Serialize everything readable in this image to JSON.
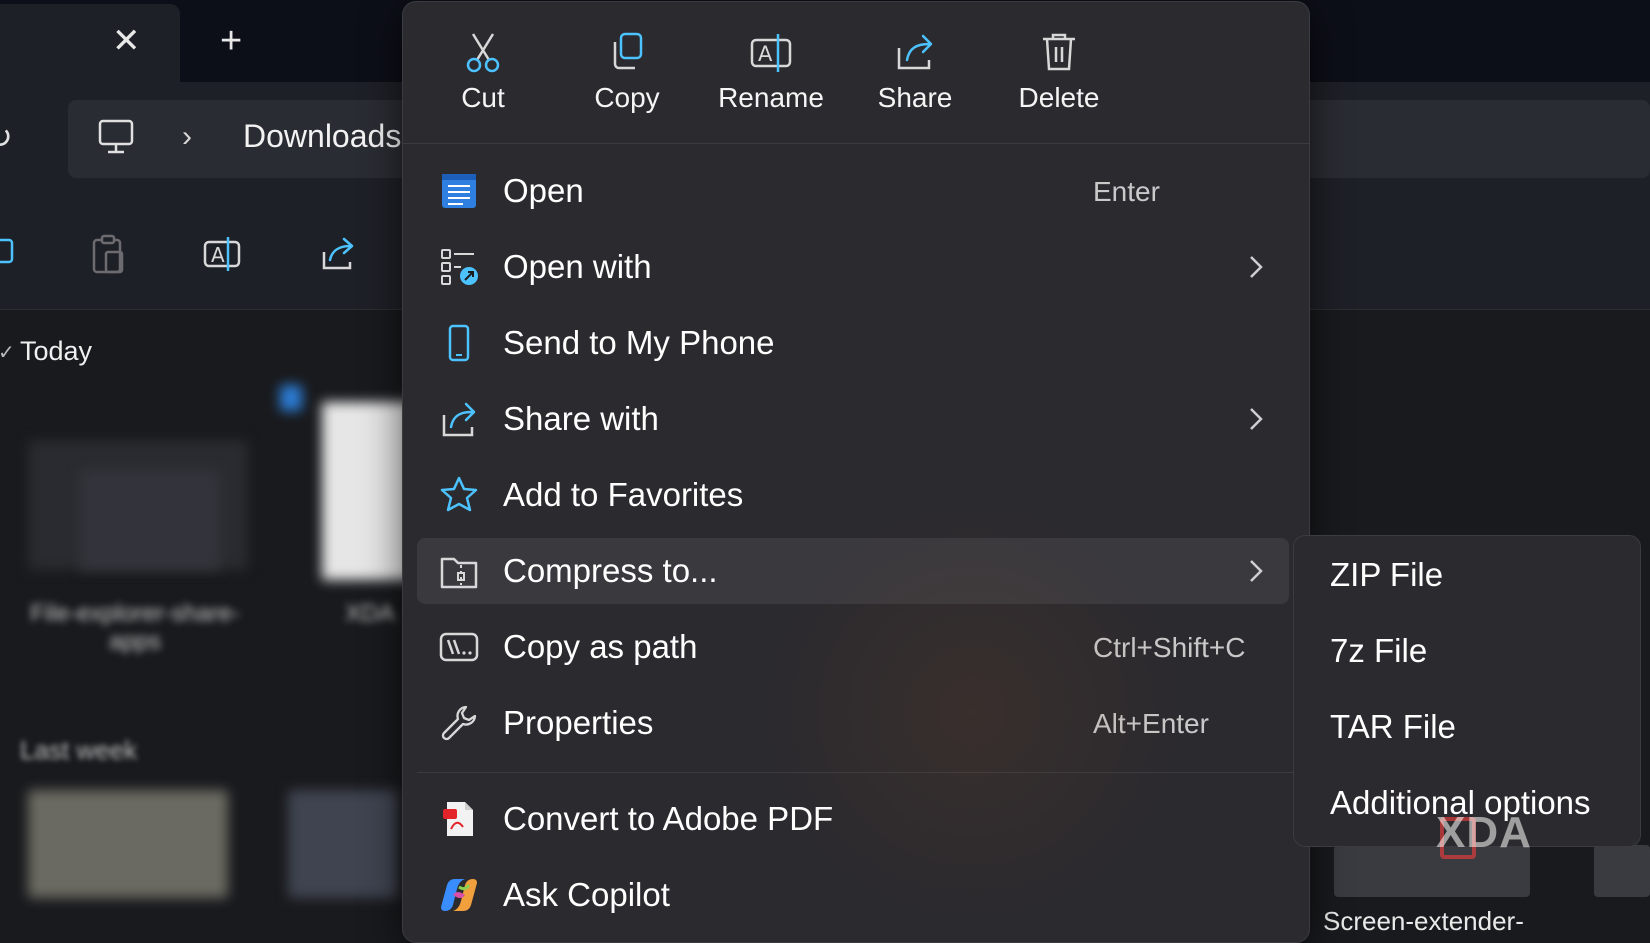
{
  "window": {
    "tab_close_glyph": "✕",
    "tab_new_glyph": "+"
  },
  "address": {
    "separator": "›",
    "location": "Downloads"
  },
  "groups": {
    "today": "Today",
    "last_week": "Last week"
  },
  "files": {
    "today_1": "File-explorer-share-apps",
    "today_2": "XDA",
    "bottom_right": "Screen-extender-"
  },
  "quick_actions": [
    {
      "label": "Cut",
      "icon": "cut-icon"
    },
    {
      "label": "Copy",
      "icon": "copy-icon"
    },
    {
      "label": "Rename",
      "icon": "rename-icon"
    },
    {
      "label": "Share",
      "icon": "share-icon"
    },
    {
      "label": "Delete",
      "icon": "delete-icon"
    }
  ],
  "menu": {
    "open": {
      "label": "Open",
      "shortcut": "Enter",
      "icon": "notepad-icon"
    },
    "open_with": {
      "label": "Open with",
      "icon": "open-with-icon"
    },
    "send_to_phone": {
      "label": "Send to My Phone",
      "icon": "phone-icon"
    },
    "share_with": {
      "label": "Share with",
      "icon": "share-icon"
    },
    "add_to_favorites": {
      "label": "Add to Favorites",
      "icon": "star-icon"
    },
    "compress_to": {
      "label": "Compress to...",
      "icon": "zip-folder-icon"
    },
    "copy_as_path": {
      "label": "Copy as path",
      "shortcut": "Ctrl+Shift+C",
      "icon": "path-icon"
    },
    "properties": {
      "label": "Properties",
      "shortcut": "Alt+Enter",
      "icon": "wrench-icon"
    },
    "convert_pdf": {
      "label": "Convert to Adobe PDF",
      "icon": "adobe-pdf-icon"
    },
    "ask_copilot": {
      "label": "Ask Copilot",
      "icon": "copilot-icon"
    }
  },
  "submenu": {
    "items": [
      "ZIP File",
      "7z File",
      "TAR File",
      "Additional options"
    ]
  },
  "watermark": "XDA",
  "colors": {
    "menu_bg": "#2b2a2e",
    "hover_bg": "#3a393e",
    "accent_blue": "#4cc2ff",
    "background": "#191a1d"
  }
}
